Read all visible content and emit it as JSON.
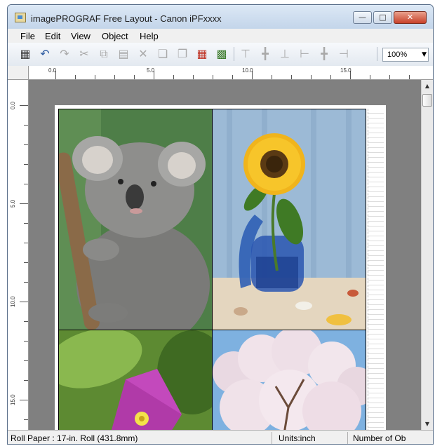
{
  "window": {
    "title": "imagePROGRAF Free Layout - Canon iPFxxxx"
  },
  "menu": [
    "File",
    "Edit",
    "View",
    "Object",
    "Help"
  ],
  "toolbar": {
    "zoom_value": "100%"
  },
  "ruler": {
    "h_labels": [
      "0.0",
      "5.0",
      "10.0",
      "15.0"
    ],
    "v_labels": [
      "0.0",
      "5.0",
      "10.0",
      "15.0"
    ]
  },
  "statusbar": {
    "paper": "Roll Paper : 17-in. Roll (431.8mm)",
    "units": "Units:inch",
    "objects": "Number of Ob"
  }
}
